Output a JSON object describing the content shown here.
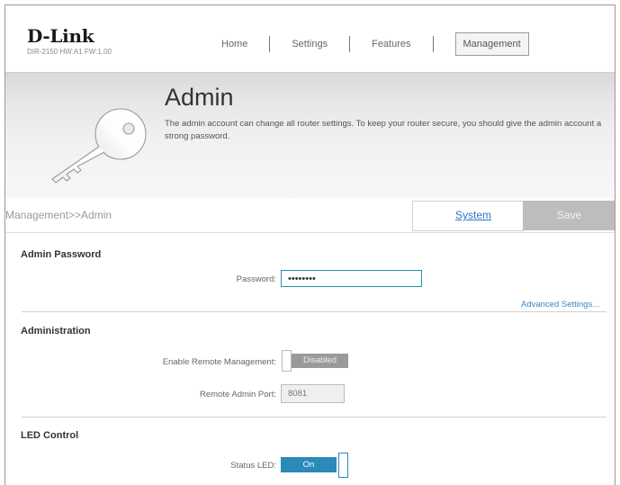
{
  "header": {
    "brand": "D-Link",
    "model": "DIR-2150 HW:A1 FW:1.00",
    "nav": [
      "Home",
      "Settings",
      "Features",
      "Management"
    ],
    "active_nav": "Management"
  },
  "banner": {
    "title": "Admin",
    "description": "The admin account can change all router settings. To keep your router secure, you should give the admin account a strong password.",
    "icon": "key-icon"
  },
  "toolbar": {
    "breadcrumb": "Management>>Admin",
    "system_link": "System",
    "save_label": "Save"
  },
  "admin_password": {
    "title": "Admin Password",
    "password_label": "Password:",
    "password_value": "••••••••",
    "advanced_link": "Advanced Settings..."
  },
  "administration": {
    "title": "Administration",
    "remote_mgmt_label": "Enable Remote Management:",
    "remote_mgmt_state": "Disabled",
    "port_label": "Remote Admin Port:",
    "port_value": "8081"
  },
  "led": {
    "title": "LED Control",
    "status_label": "Status LED:",
    "status_state": "On"
  },
  "colors": {
    "accent": "#2b8ab8",
    "link": "#2a76c6",
    "disabled": "#9a9a9a"
  }
}
